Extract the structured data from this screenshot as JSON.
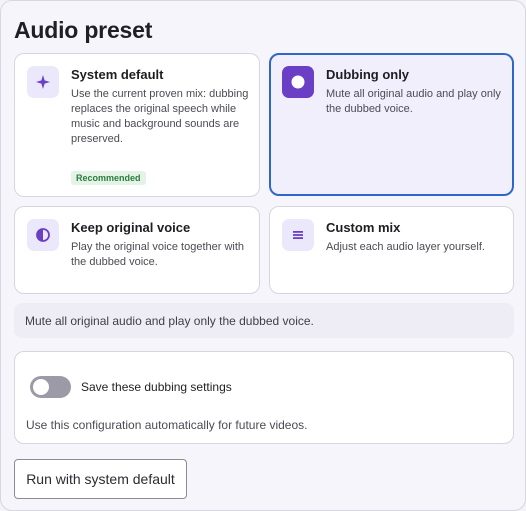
{
  "title": "Audio preset",
  "presets": [
    {
      "title": "System default",
      "description": "Use the current proven mix: dubbing replaces the original speech while music and background sounds are preserved.",
      "badge": "Recommended",
      "icon": "sparkle-icon",
      "selected": false
    },
    {
      "title": "Dubbing only",
      "description": "Mute all original audio and play only the dubbed voice.",
      "icon": "record-circle-icon",
      "selected": true
    },
    {
      "title": "Keep original voice",
      "description": "Play the original voice together with the dubbed voice.",
      "icon": "half-circle-icon",
      "selected": false
    },
    {
      "title": "Custom mix",
      "description": "Adjust each audio layer yourself.",
      "icon": "layers-icon",
      "selected": false
    }
  ],
  "selection_note": "Mute all original audio and play only the dubbed voice.",
  "save_settings": {
    "label": "Save these dubbing settings",
    "description": "Use this configuration automatically for future videos.",
    "enabled": false
  },
  "run_button": "Run with system default",
  "colors": {
    "accent": "#6a3fc6",
    "selected_border": "#2f67c9",
    "badge_bg": "#e3f4e6",
    "badge_text": "#2d7a3e"
  }
}
